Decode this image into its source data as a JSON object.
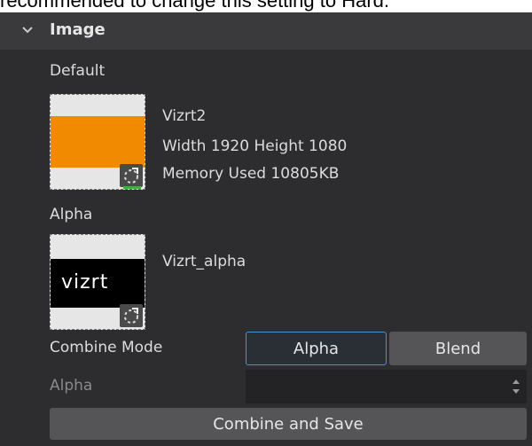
{
  "top_text": "recommended to change this setting to Hard.",
  "section": {
    "title": "Image"
  },
  "default_image": {
    "label": "Default",
    "name": "Vizrt2",
    "dimensions": "Width 1920   Height 1080",
    "memory": "Memory Used 10805KB"
  },
  "alpha_image": {
    "label": "Alpha",
    "name": "Vizrt_alpha",
    "logo_text": "vizrt"
  },
  "combine_mode": {
    "label": "Combine Mode",
    "options": [
      "Alpha",
      "Blend"
    ],
    "selected": "Alpha"
  },
  "alpha_field": {
    "label": "Alpha",
    "value": ""
  },
  "actions": {
    "combine_save": "Combine and Save"
  },
  "colors": {
    "panel_bg": "#2d2d30",
    "header_bg": "#3a3a3d",
    "accent_blue": "#4a90d9",
    "thumb_orange": "#f28a00"
  },
  "icons": [
    "chevron-down-icon",
    "reload-icon",
    "stepper-icon"
  ]
}
